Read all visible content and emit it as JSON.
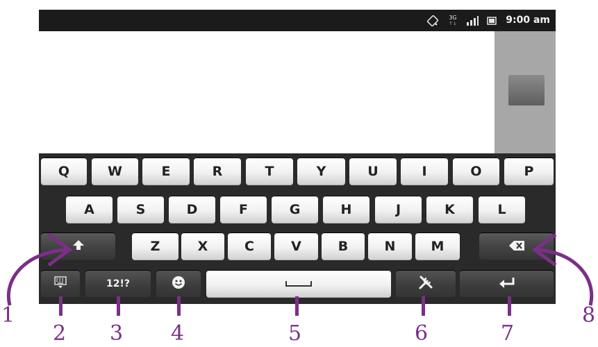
{
  "status_bar": {
    "time": "9:00 am",
    "network": "3G",
    "icons": [
      "auto-rotate-icon",
      "network-3g-icon",
      "signal-bars-icon",
      "sd-card-icon"
    ]
  },
  "keyboard": {
    "row1": [
      "Q",
      "W",
      "E",
      "R",
      "T",
      "Y",
      "U",
      "I",
      "O",
      "P"
    ],
    "row2": [
      "A",
      "S",
      "D",
      "F",
      "G",
      "H",
      "J",
      "K",
      "L"
    ],
    "row3": [
      "Z",
      "X",
      "C",
      "V",
      "B",
      "N",
      "M"
    ],
    "symbols_label": "12!?",
    "shift_icon": "shift-arrow-icon",
    "backspace_icon": "backspace-icon",
    "hide_icon": "keyboard-hide-icon",
    "smiley_icon": "smiley-icon",
    "settings_icon": "tools-icon",
    "enter_icon": "enter-arrow-icon"
  },
  "callouts": {
    "labels": [
      "1",
      "2",
      "3",
      "4",
      "5",
      "6",
      "7",
      "8"
    ],
    "color": "#7b2f88"
  }
}
